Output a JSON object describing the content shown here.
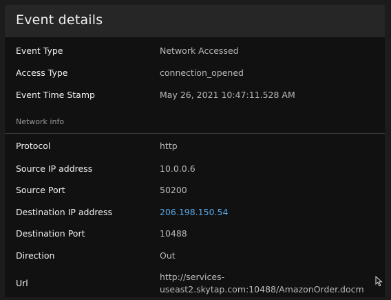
{
  "panel": {
    "title": "Event details"
  },
  "event": {
    "rows": [
      {
        "label": "Event Type",
        "value": "Network Accessed"
      },
      {
        "label": "Access Type",
        "value": "connection_opened"
      },
      {
        "label": "Event Time Stamp",
        "value": "May 26, 2021 10:47:11.528 AM"
      }
    ]
  },
  "network": {
    "section_label": "Network info",
    "rows": [
      {
        "label": "Protocol",
        "value": "http"
      },
      {
        "label": "Source IP address",
        "value": "10.0.0.6"
      },
      {
        "label": "Source Port",
        "value": "50200"
      },
      {
        "label": "Destination IP address",
        "value": "206.198.150.54"
      },
      {
        "label": "Destination Port",
        "value": "10488"
      },
      {
        "label": "Direction",
        "value": "Out"
      }
    ],
    "url": {
      "label": "Url",
      "line1": "http://services-",
      "line2": "useast2.skytap.com:10488/AmazonOrder.docm"
    }
  },
  "colors": {
    "link": "#5aa8e6"
  },
  "icons": {
    "cursor": "mouse-pointer-icon"
  }
}
